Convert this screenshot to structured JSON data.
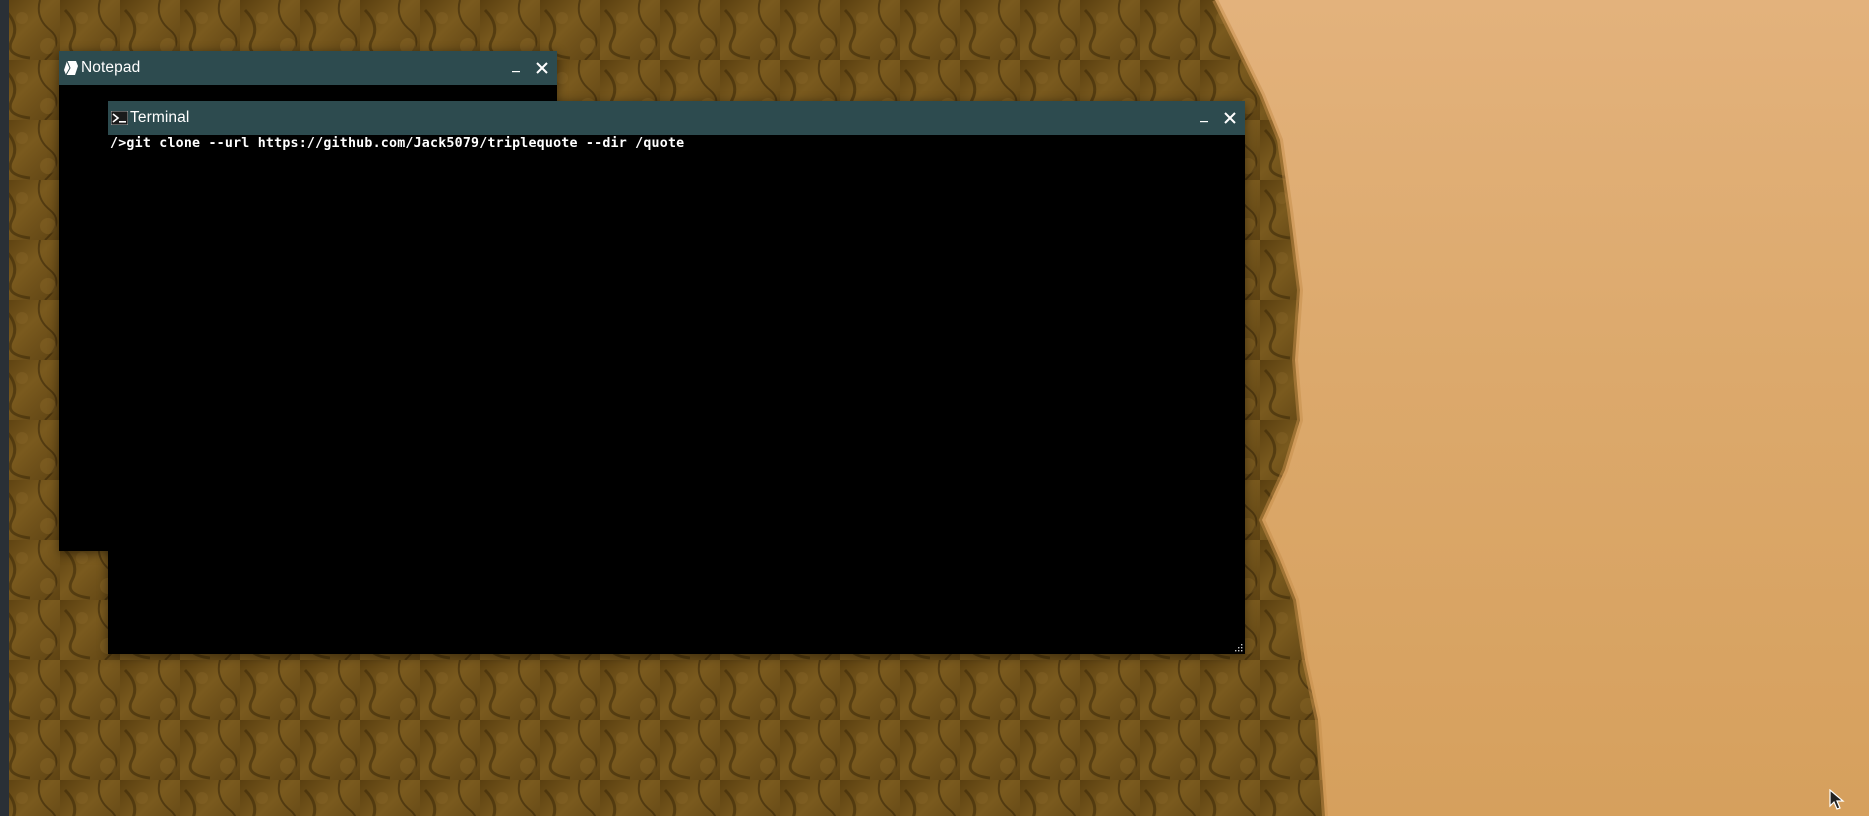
{
  "desktop": {
    "wallpaper_colors": {
      "sky": "#dca96c",
      "rock": "#6e5018",
      "rock_shadow": "#3f2c0b"
    }
  },
  "windows": {
    "notepad": {
      "title": "Notepad",
      "icon": "notepad-icon",
      "titlebar_color": "#2d4b4f",
      "minimize_label": "_",
      "close_label": "✕"
    },
    "terminal": {
      "title": "Terminal",
      "icon": "terminal-prompt-icon",
      "titlebar_color": "#2d4b4f",
      "minimize_label": "_",
      "close_label": "✕",
      "lines": [
        "/>git clone --url https://github.com/Jack5079/triplequote --dir /quote"
      ]
    }
  }
}
